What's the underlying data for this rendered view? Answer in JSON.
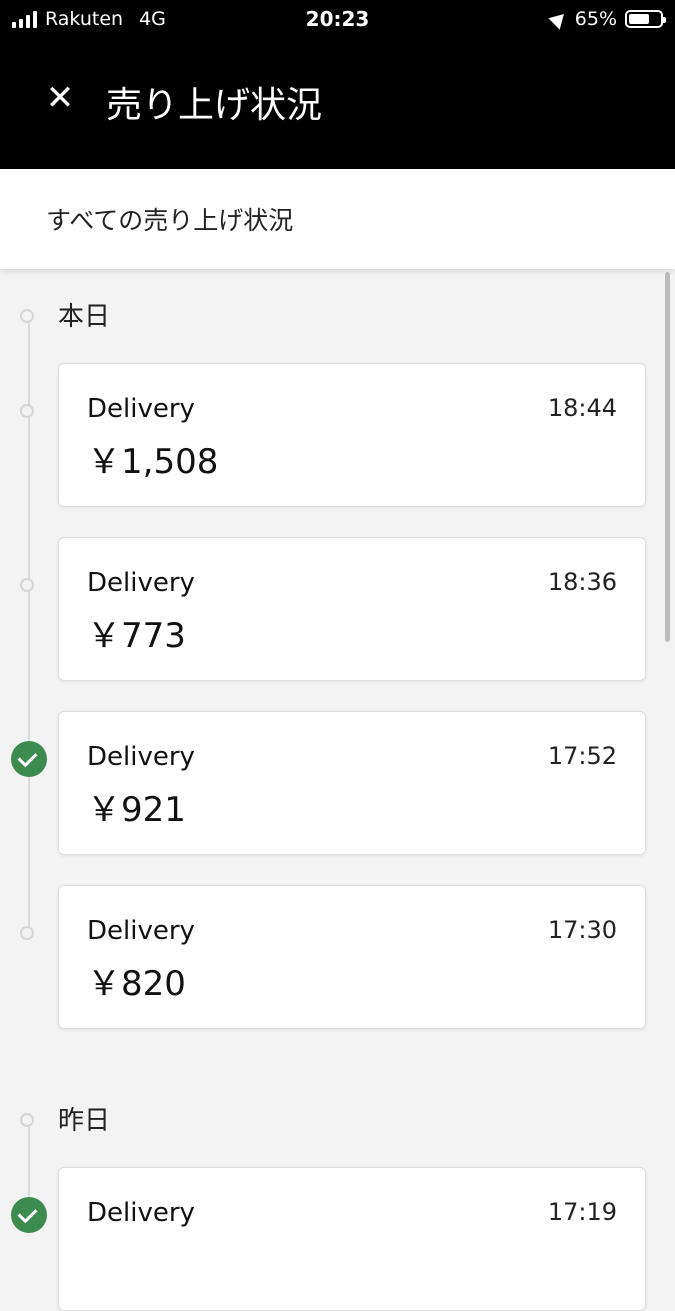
{
  "status_bar": {
    "carrier": "Rakuten",
    "network": "4G",
    "time": "20:23",
    "battery": "65%",
    "battery_level": 0.65
  },
  "header": {
    "close_icon": "close-icon",
    "title": "売り上げ状況"
  },
  "filter": {
    "label": "すべての売り上げ状況"
  },
  "sections": [
    {
      "label": "本日",
      "items": [
        {
          "kind": "Delivery",
          "time": "18:44",
          "amount": "￥1,508",
          "completed": false
        },
        {
          "kind": "Delivery",
          "time": "18:36",
          "amount": "￥773",
          "completed": false
        },
        {
          "kind": "Delivery",
          "time": "17:52",
          "amount": "￥921",
          "completed": true
        },
        {
          "kind": "Delivery",
          "time": "17:30",
          "amount": "￥820",
          "completed": false
        }
      ]
    },
    {
      "label": "昨日",
      "items": [
        {
          "kind": "Delivery",
          "time": "17:19",
          "amount": "",
          "completed": true
        }
      ]
    }
  ],
  "colors": {
    "header_bg": "#000000",
    "completed_green": "#3d8b4e",
    "page_bg": "#f3f3f3"
  }
}
